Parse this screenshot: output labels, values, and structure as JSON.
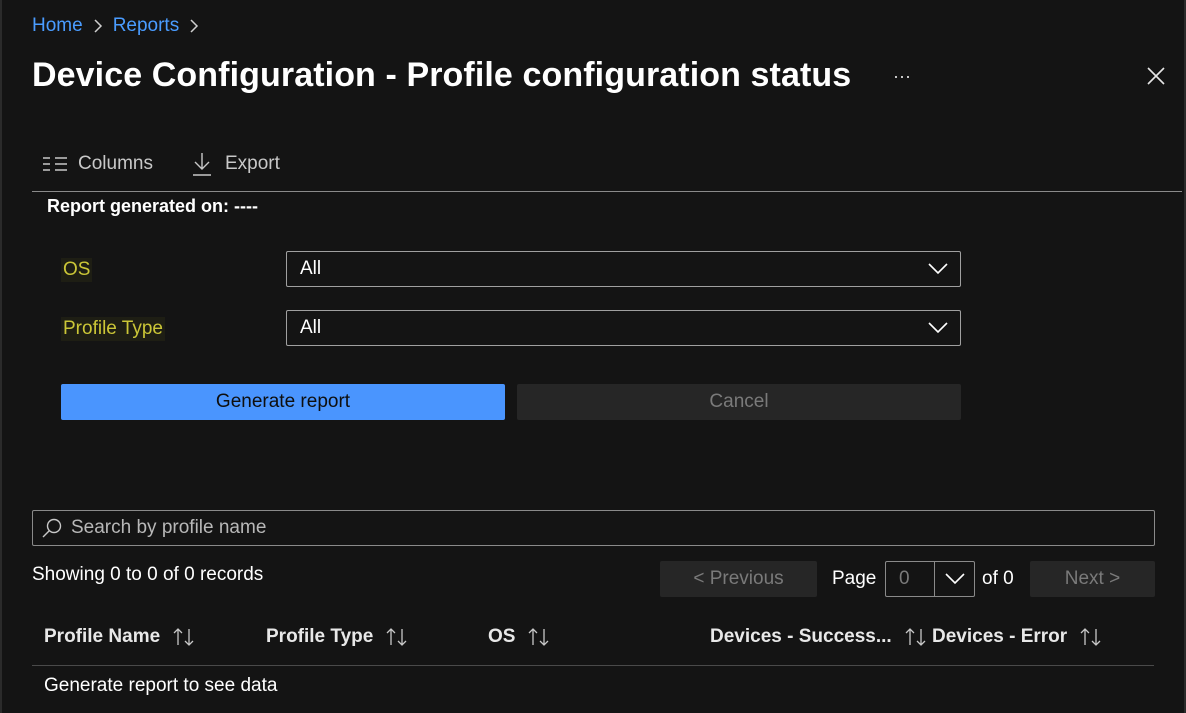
{
  "breadcrumb": {
    "home": "Home",
    "reports": "Reports"
  },
  "title": "Device Configuration - Profile configuration status",
  "more_label": "···",
  "toolbar": {
    "columns": "Columns",
    "export": "Export"
  },
  "report_generated": "Report generated on: ----",
  "filters": {
    "os": {
      "label": "OS",
      "value": "All"
    },
    "profile_type": {
      "label": "Profile Type",
      "value": "All"
    }
  },
  "buttons": {
    "generate": "Generate report",
    "cancel": "Cancel"
  },
  "search": {
    "placeholder": "Search by profile name",
    "value": ""
  },
  "pagination": {
    "records": "Showing 0 to 0 of 0 records",
    "previous": "< Previous",
    "page_label": "Page",
    "page_value": "0",
    "of_label": "of 0",
    "next": "Next >"
  },
  "table": {
    "columns": [
      "Profile Name",
      "Profile Type",
      "OS",
      "Devices - Success...",
      "Devices - Error"
    ],
    "empty_message": "Generate report to see data"
  },
  "colors": {
    "background": "#141414",
    "link": "#4a9cff",
    "primary_button": "#4a95fe",
    "filter_label": "#cbc637"
  },
  "icons": [
    "chevron-right-icon",
    "more-icon",
    "close-icon",
    "columns-icon",
    "download-icon",
    "chevron-down-icon",
    "search-icon",
    "sort-icon"
  ]
}
